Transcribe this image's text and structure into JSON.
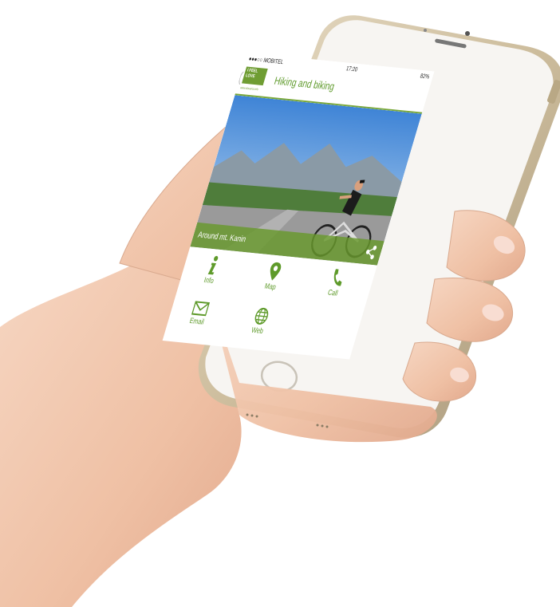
{
  "status_bar": {
    "carrier": "●●●○○ MOBITEL",
    "time": "17:20",
    "battery": "82%"
  },
  "header": {
    "logo_line1": "I FEEL",
    "logo_line2": "LOVE",
    "logo_url": "www.slovenia.info",
    "title": "Hiking and biking"
  },
  "photo": {
    "caption": "Around mt. Kanin"
  },
  "actions": [
    {
      "label": "Info",
      "icon": "info-icon"
    },
    {
      "label": "Map",
      "icon": "map-pin-icon"
    },
    {
      "label": "Call",
      "icon": "phone-icon"
    },
    {
      "label": "Email",
      "icon": "envelope-icon"
    },
    {
      "label": "Web",
      "icon": "globe-icon"
    }
  ],
  "colors": {
    "accent": "#6f9d33",
    "phone_body": "#d9cdb6",
    "phone_face": "#f7f5f2",
    "skin": "#f1c7ad"
  }
}
